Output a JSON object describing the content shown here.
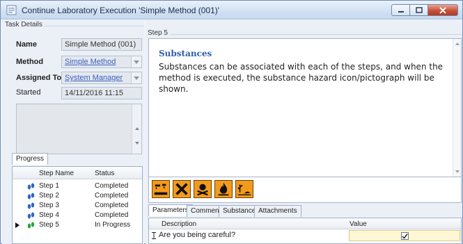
{
  "window": {
    "title": "Continue Laboratory Execution 'Simple Method (001)'"
  },
  "task_details": {
    "section_label": "Task Details",
    "name_label": "Name",
    "name_value": "Simple Method (001)",
    "method_label": "Method",
    "method_value": "Simple Method",
    "assigned_label": "Assigned To",
    "assigned_value": "System Manager",
    "started_label": "Started",
    "started_value": "14/11/2016 11:15"
  },
  "progress": {
    "tab_label": "Progress",
    "columns": [
      "Step Name",
      "Status"
    ],
    "rows": [
      {
        "step": "Step 1",
        "status": "Completed"
      },
      {
        "step": "Step 2",
        "status": "Completed"
      },
      {
        "step": "Step 3",
        "status": "Completed"
      },
      {
        "step": "Step 4",
        "status": "Completed"
      },
      {
        "step": "Step 5",
        "status": "In Progress"
      }
    ]
  },
  "step": {
    "section_label": "Step 5",
    "heading": "Substances",
    "body": "Substances can be associated with each of the steps, and when the method is executed, the substance hazard icon/pictograph will be shown."
  },
  "hazard_icons": [
    "corrosive-icon",
    "harmful-icon",
    "toxic-icon",
    "flammable-icon",
    "environment-icon"
  ],
  "bottom_tabs": [
    "Parameters",
    "Comments",
    "Substances",
    "Attachments"
  ],
  "parameters": {
    "columns": [
      "Description",
      "Value"
    ],
    "row_description": "Are you being careful?",
    "row_checked": true
  },
  "colors": {
    "link": "#3a5fbd",
    "heading": "#2e5ea6",
    "hazard_orange": "#f39a1d",
    "value_highlight": "#fdf7d6"
  }
}
